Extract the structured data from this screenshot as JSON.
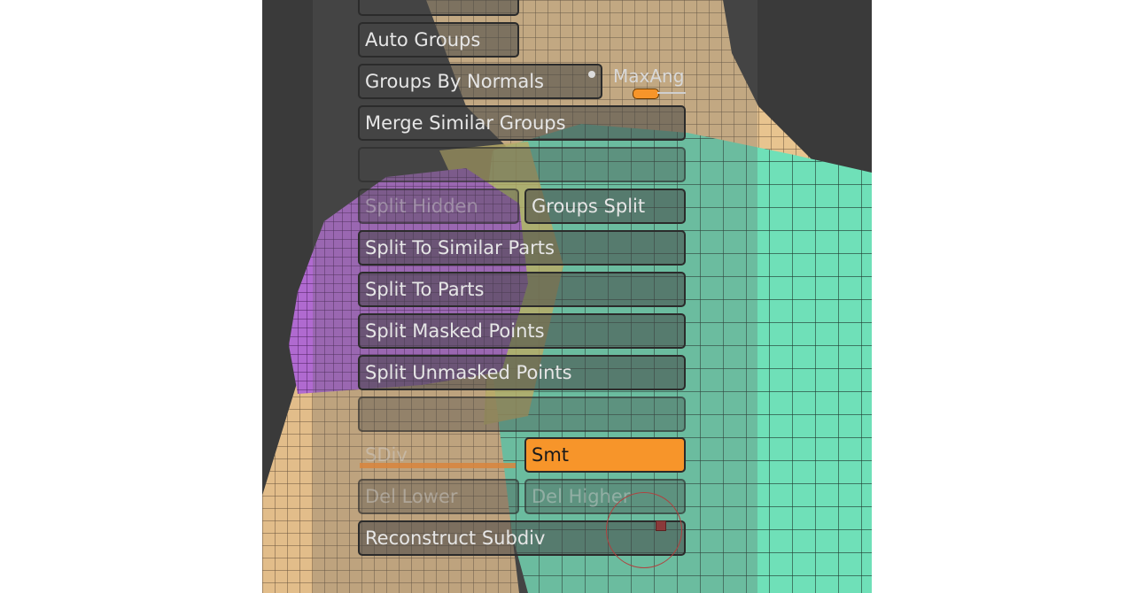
{
  "panel": {
    "auto_groups": "Auto Groups",
    "groups_by_normals": "Groups By Normals",
    "max_angle_label": "MaxAng",
    "merge_similar_groups": "Merge Similar Groups",
    "split_hidden": "Split Hidden",
    "groups_split": "Groups Split",
    "split_to_similar_parts": "Split To Similar Parts",
    "split_to_parts": "Split To Parts",
    "split_masked_points": "Split Masked Points",
    "split_unmasked_points": "Split Unmasked Points",
    "sdiv": "SDiv",
    "smt": "Smt",
    "del_lower": "Del Lower",
    "del_higher": "Del Higher",
    "reconstruct_subdiv": "Reconstruct Subdiv"
  },
  "colors": {
    "accent_orange": "#f7952a",
    "mesh_skin": "#e8c48f",
    "mesh_teal": "#6fe0b8",
    "mesh_purple": "#b06ad0",
    "viewport_bg": "#3a3a3a"
  }
}
